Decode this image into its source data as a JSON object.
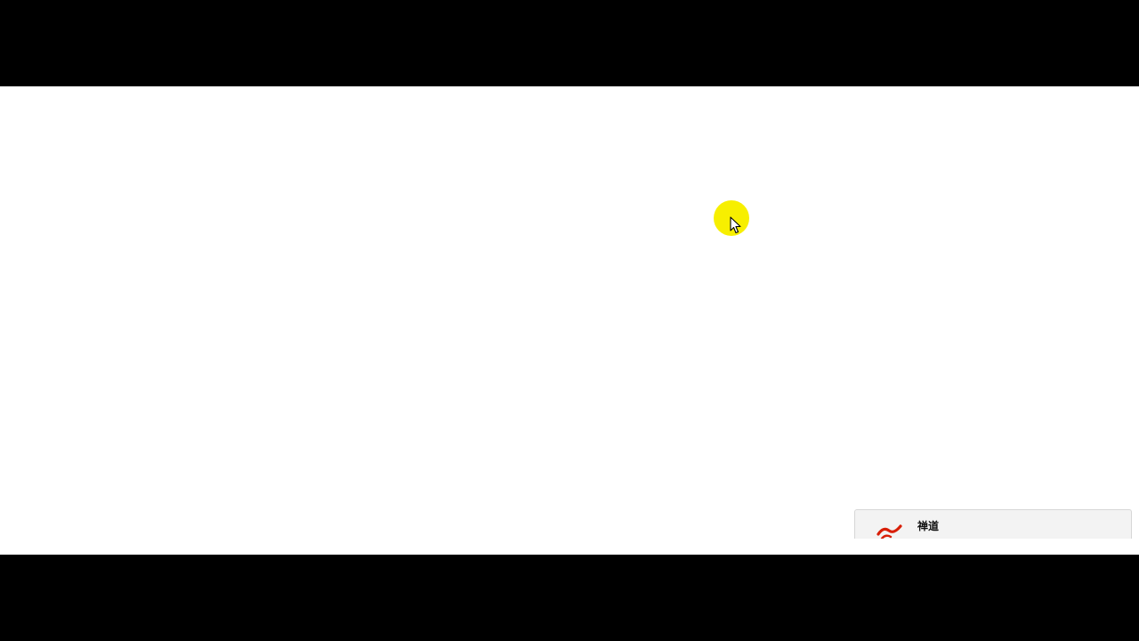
{
  "colors": {
    "letterbox": "#000000",
    "screen_background": "#ffffff",
    "cursor_highlight": "#f7ef00",
    "notification_background": "#f3f3f3",
    "logo_red": "#d81e06"
  },
  "cursor": {
    "icon": "arrow-pointer-icon",
    "highlight": "yellow-circle"
  },
  "notification": {
    "logo_icon": "zentao-logo-icon",
    "title": "禅道",
    "body": ""
  }
}
